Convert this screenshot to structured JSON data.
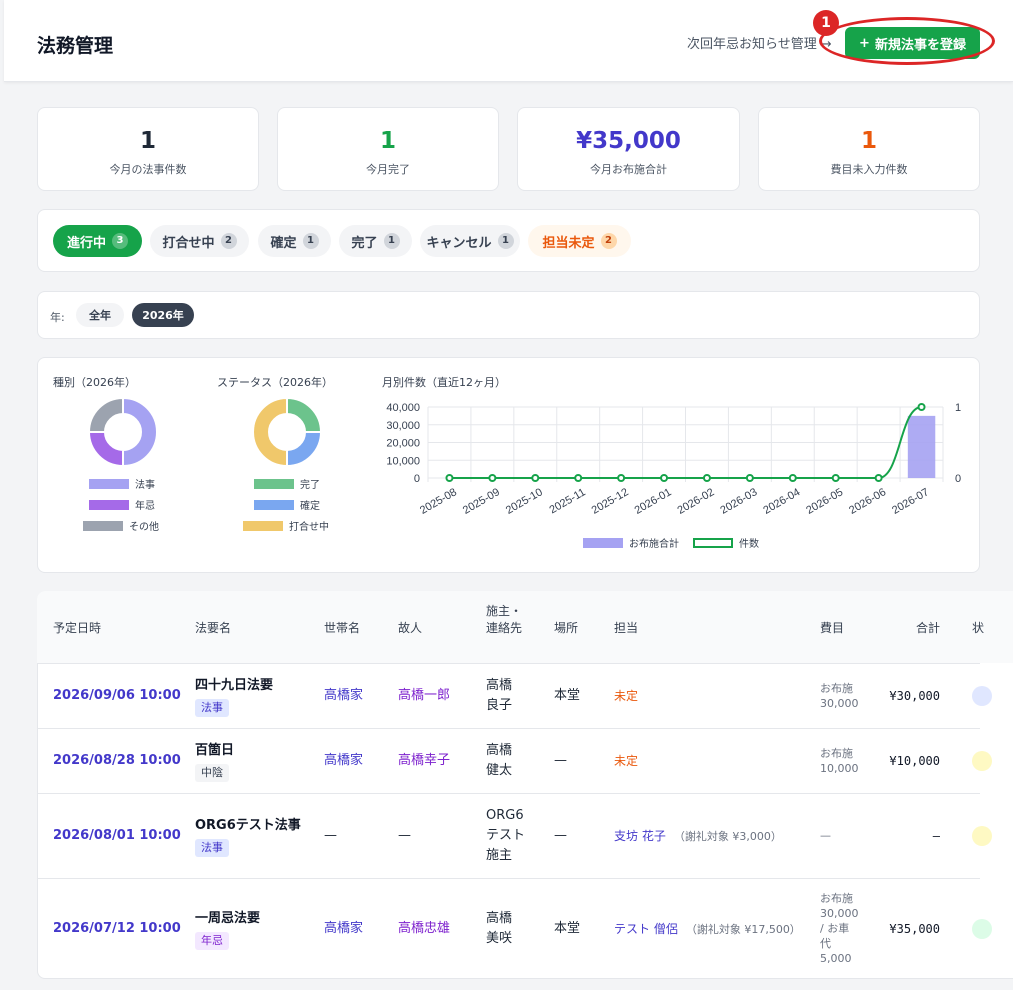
{
  "header": {
    "title": "法務管理",
    "notice_link": "次回年忌お知らせ管理",
    "notice_arrow": "→",
    "new_button": "新規法事を登録",
    "new_button_icon": "+",
    "highlight_number": "1"
  },
  "stats": [
    {
      "value": "1",
      "label": "今月の法事件数",
      "color": "#111827"
    },
    {
      "value": "1",
      "label": "今月完了",
      "color": "#16a34a"
    },
    {
      "value": "¥35,000",
      "label": "今月お布施合計",
      "color": "#4338ca"
    },
    {
      "value": "1",
      "label": "費目未入力件数",
      "color": "#ea580c"
    }
  ],
  "filters": [
    {
      "label": "進行中",
      "count": "3"
    },
    {
      "label": "打合せ中",
      "count": "2"
    },
    {
      "label": "確定",
      "count": "1"
    },
    {
      "label": "完了",
      "count": "1"
    },
    {
      "label": "キャンセル",
      "count": "1"
    },
    {
      "label": "担当未定",
      "count": "2"
    }
  ],
  "year_filter": {
    "label": "年:",
    "options": [
      "全年",
      "2026年"
    ],
    "selected": "2026年"
  },
  "charts": {
    "type_title": "種別（2026年）",
    "status_title": "ステータス（2026年）",
    "monthly_title": "月別件数（直近12ヶ月）"
  },
  "chart_data": [
    {
      "type": "pie",
      "title": "種別（2026年）",
      "labels": [
        "法事",
        "年忌",
        "その他"
      ],
      "values": [
        2,
        1,
        1
      ],
      "colors": [
        "#a5a2f2",
        "#a56ae8",
        "#9ca3af"
      ]
    },
    {
      "type": "pie",
      "title": "ステータス（2026年）",
      "labels": [
        "完了",
        "確定",
        "打合せ中"
      ],
      "values": [
        1,
        1,
        2
      ],
      "colors": [
        "#6cc38c",
        "#7aa7f0",
        "#f0c86b"
      ]
    },
    {
      "type": "bar",
      "title": "月別件数（直近12ヶ月）",
      "categories": [
        "2025-08",
        "2025-09",
        "2025-10",
        "2025-11",
        "2025-12",
        "2026-01",
        "2026-02",
        "2026-03",
        "2026-04",
        "2026-05",
        "2026-06",
        "2026-07"
      ],
      "series": [
        {
          "name": "お布施合計",
          "type": "bar",
          "axis": "left",
          "color": "#a5a2f2",
          "values": [
            0,
            0,
            0,
            0,
            0,
            0,
            0,
            0,
            0,
            0,
            0,
            35000
          ]
        },
        {
          "name": "件数",
          "type": "line",
          "axis": "right",
          "color": "#16a34a",
          "values": [
            0,
            0,
            0,
            0,
            0,
            0,
            0,
            0,
            0,
            0,
            0,
            1
          ]
        }
      ],
      "ylim_left": [
        0,
        40000
      ],
      "yticks_left": [
        "40,000",
        "30,000",
        "20,000",
        "10,000",
        "0"
      ],
      "ylim_right": [
        0,
        1
      ],
      "yticks_right": [
        "1",
        "0"
      ],
      "grid": true,
      "legend": "bottom"
    }
  ],
  "table": {
    "headers": [
      "予定日時",
      "法要名",
      "世帯名",
      "故人",
      "施主・連絡先",
      "場所",
      "担当",
      "費目",
      "合計",
      "状"
    ],
    "rows": [
      {
        "date": "2026/09/06 10:00",
        "name": "四十九日法要",
        "tag": "法事",
        "family": "高橋家",
        "deceased": "高橋一郎",
        "host": [
          "高橋",
          "良子"
        ],
        "place": "本堂",
        "staff": "未定",
        "staff_note": "",
        "expense": [
          "お布施",
          "30,000"
        ],
        "total": "¥30,000",
        "status_color": "#e0e7ff"
      },
      {
        "date": "2026/08/28 10:00",
        "name": "百箇日",
        "tag": "中陰",
        "family": "高橋家",
        "deceased": "高橋幸子",
        "host": [
          "高橋",
          "健太"
        ],
        "place": "—",
        "staff": "未定",
        "staff_note": "",
        "expense": [
          "お布施",
          "10,000"
        ],
        "total": "¥10,000",
        "status_color": "#fef9c3"
      },
      {
        "date": "2026/08/01 10:00",
        "name": "ORG6テスト法事",
        "tag": "法事",
        "family": "—",
        "deceased": "—",
        "host": [
          "ORG6",
          "テスト",
          "施主"
        ],
        "place": "—",
        "staff": "支坊 花子",
        "staff_note": "（謝礼対象 ¥3,000）",
        "expense": [
          "—"
        ],
        "total": "–",
        "status_color": "#fef9c3"
      },
      {
        "date": "2026/07/12 10:00",
        "name": "一周忌法要",
        "tag": "年忌",
        "family": "高橋家",
        "deceased": "高橋忠雄",
        "host": [
          "高橋",
          "美咲"
        ],
        "place": "本堂",
        "staff": "テスト 僧侶",
        "staff_note": "（謝礼対象 ¥17,500）",
        "expense": [
          "お布施",
          "30,000",
          "/ お車",
          "代",
          "5,000"
        ],
        "total": "¥35,000",
        "status_color": "#dcfce7"
      }
    ]
  }
}
